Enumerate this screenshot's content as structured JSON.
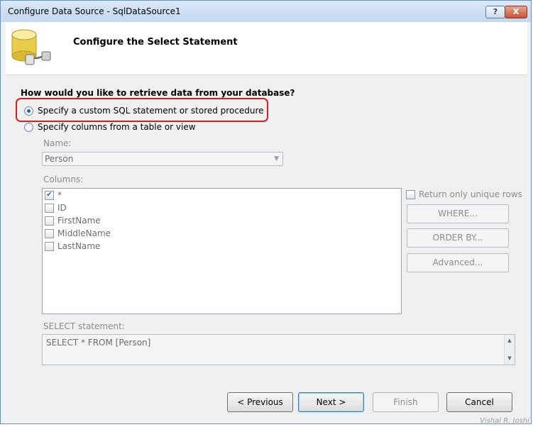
{
  "window": {
    "title": "Configure Data Source - SqlDataSource1",
    "help_label": "?",
    "close_label": "X"
  },
  "header": {
    "title": "Configure the Select Statement",
    "icon": "database-plug-icon"
  },
  "question": "How would you like to retrieve data from your database?",
  "options": {
    "custom": {
      "label": "Specify a custom SQL statement or stored procedure",
      "selected": true
    },
    "columns": {
      "label": "Specify columns from a table or view",
      "selected": false
    }
  },
  "name_label": "Name:",
  "table_name": "Person",
  "columns_label": "Columns:",
  "columns": [
    {
      "name": "*",
      "checked": true
    },
    {
      "name": "ID",
      "checked": false
    },
    {
      "name": "FirstName",
      "checked": false
    },
    {
      "name": "MiddleName",
      "checked": false
    },
    {
      "name": "LastName",
      "checked": false
    }
  ],
  "unique_rows_label": "Return only unique rows",
  "buttons": {
    "where": "WHERE...",
    "order_by": "ORDER BY...",
    "advanced": "Advanced..."
  },
  "select_label": "SELECT statement:",
  "select_statement": "SELECT * FROM [Person]",
  "footer": {
    "previous": "< Previous",
    "next": "Next >",
    "finish": "Finish",
    "cancel": "Cancel"
  },
  "watermark": "Vishal R. Joshi",
  "colors": {
    "highlight": "#d21f1f",
    "title_bar": "#c4d7ef"
  }
}
